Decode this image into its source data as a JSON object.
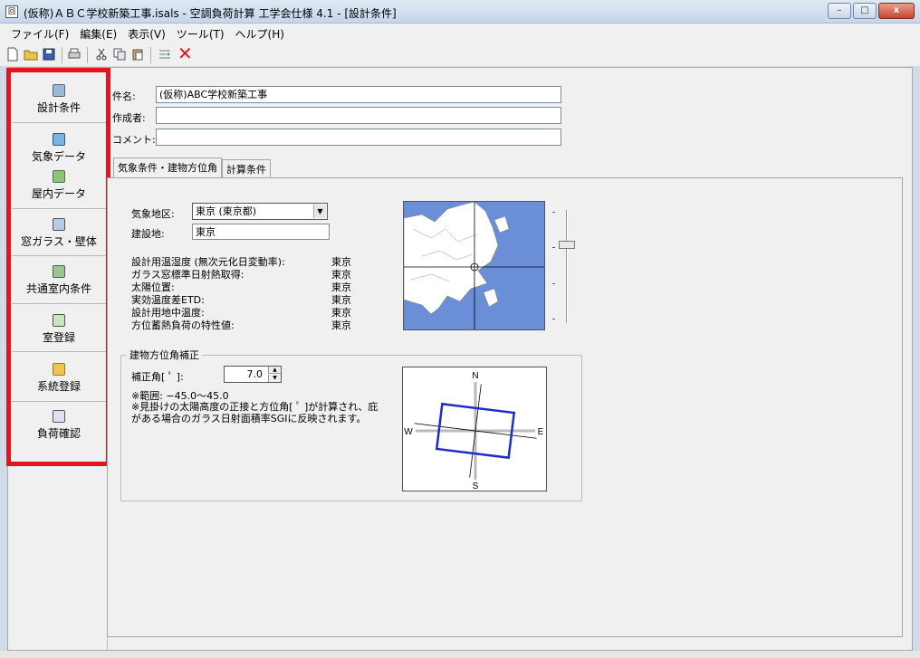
{
  "window": {
    "app_icon_text": "回",
    "title": "(仮称)ＡＢＣ学校新築工事.isals - 空調負荷計算 工学会仕様 4.1 - [設計条件]",
    "min_label": "–",
    "max_label": "□",
    "close_label": "x"
  },
  "menu": {
    "items": [
      "ファイル(F)",
      "編集(E)",
      "表示(V)",
      "ツール(T)",
      "ヘルプ(H)"
    ]
  },
  "toolbar": {
    "delete_label": "✕"
  },
  "sidebar": {
    "items": [
      {
        "label": "設計条件",
        "icon": "design-conditions-icon"
      },
      {
        "label": "気象データ",
        "icon": "weather-data-icon"
      },
      {
        "label": "屋内データ",
        "icon": "indoor-data-icon"
      },
      {
        "label": "窓ガラス・壁体",
        "icon": "window-wall-icon"
      },
      {
        "label": "共通室内条件",
        "icon": "common-room-icon"
      },
      {
        "label": "室登録",
        "icon": "room-register-icon"
      },
      {
        "label": "系統登録",
        "icon": "system-register-icon"
      },
      {
        "label": "負荷確認",
        "icon": "load-check-icon"
      }
    ]
  },
  "form": {
    "project_name_label": "件名:",
    "project_name_value": "(仮称)ABC学校新築工事",
    "author_label": "作成者:",
    "author_value": "",
    "comment_label": "コメント:",
    "comment_value": ""
  },
  "tabs": [
    "気象条件・建物方位角",
    "計算条件"
  ],
  "weather": {
    "region_label": "気象地区:",
    "region_value": "東京 (東京都)",
    "site_label": "建設地:",
    "site_value": "東京",
    "rows": [
      {
        "label": "設計用温湿度 (無次元化日変動率):",
        "value": "東京"
      },
      {
        "label": "ガラス窓標準日射熱取得:",
        "value": "東京"
      },
      {
        "label": "太陽位置:",
        "value": "東京"
      },
      {
        "label": "実効温度差ETD:",
        "value": "東京"
      },
      {
        "label": "設計用地中温度:",
        "value": "東京"
      },
      {
        "label": "方位蓄熱負荷の特性値:",
        "value": "東京"
      }
    ]
  },
  "orientation": {
    "group_title": "建物方位角補正",
    "angle_label": "補正角[ ﾟ ]:",
    "angle_value": "7.0",
    "range_note": "※範囲: −45.0〜45.0",
    "note": "※見掛けの太陽高度の正接と方位角[ ﾟ ]が計算され、庇がある場合のガラス日射面積率SGIに反映されます。",
    "north": "N",
    "south": "S",
    "east": "E",
    "west": "W",
    "angle_deg": 7.0
  },
  "colors": {
    "highlight": "#e4141c",
    "map_sea": "#6a8fd6",
    "building": "#1a2fc8"
  }
}
